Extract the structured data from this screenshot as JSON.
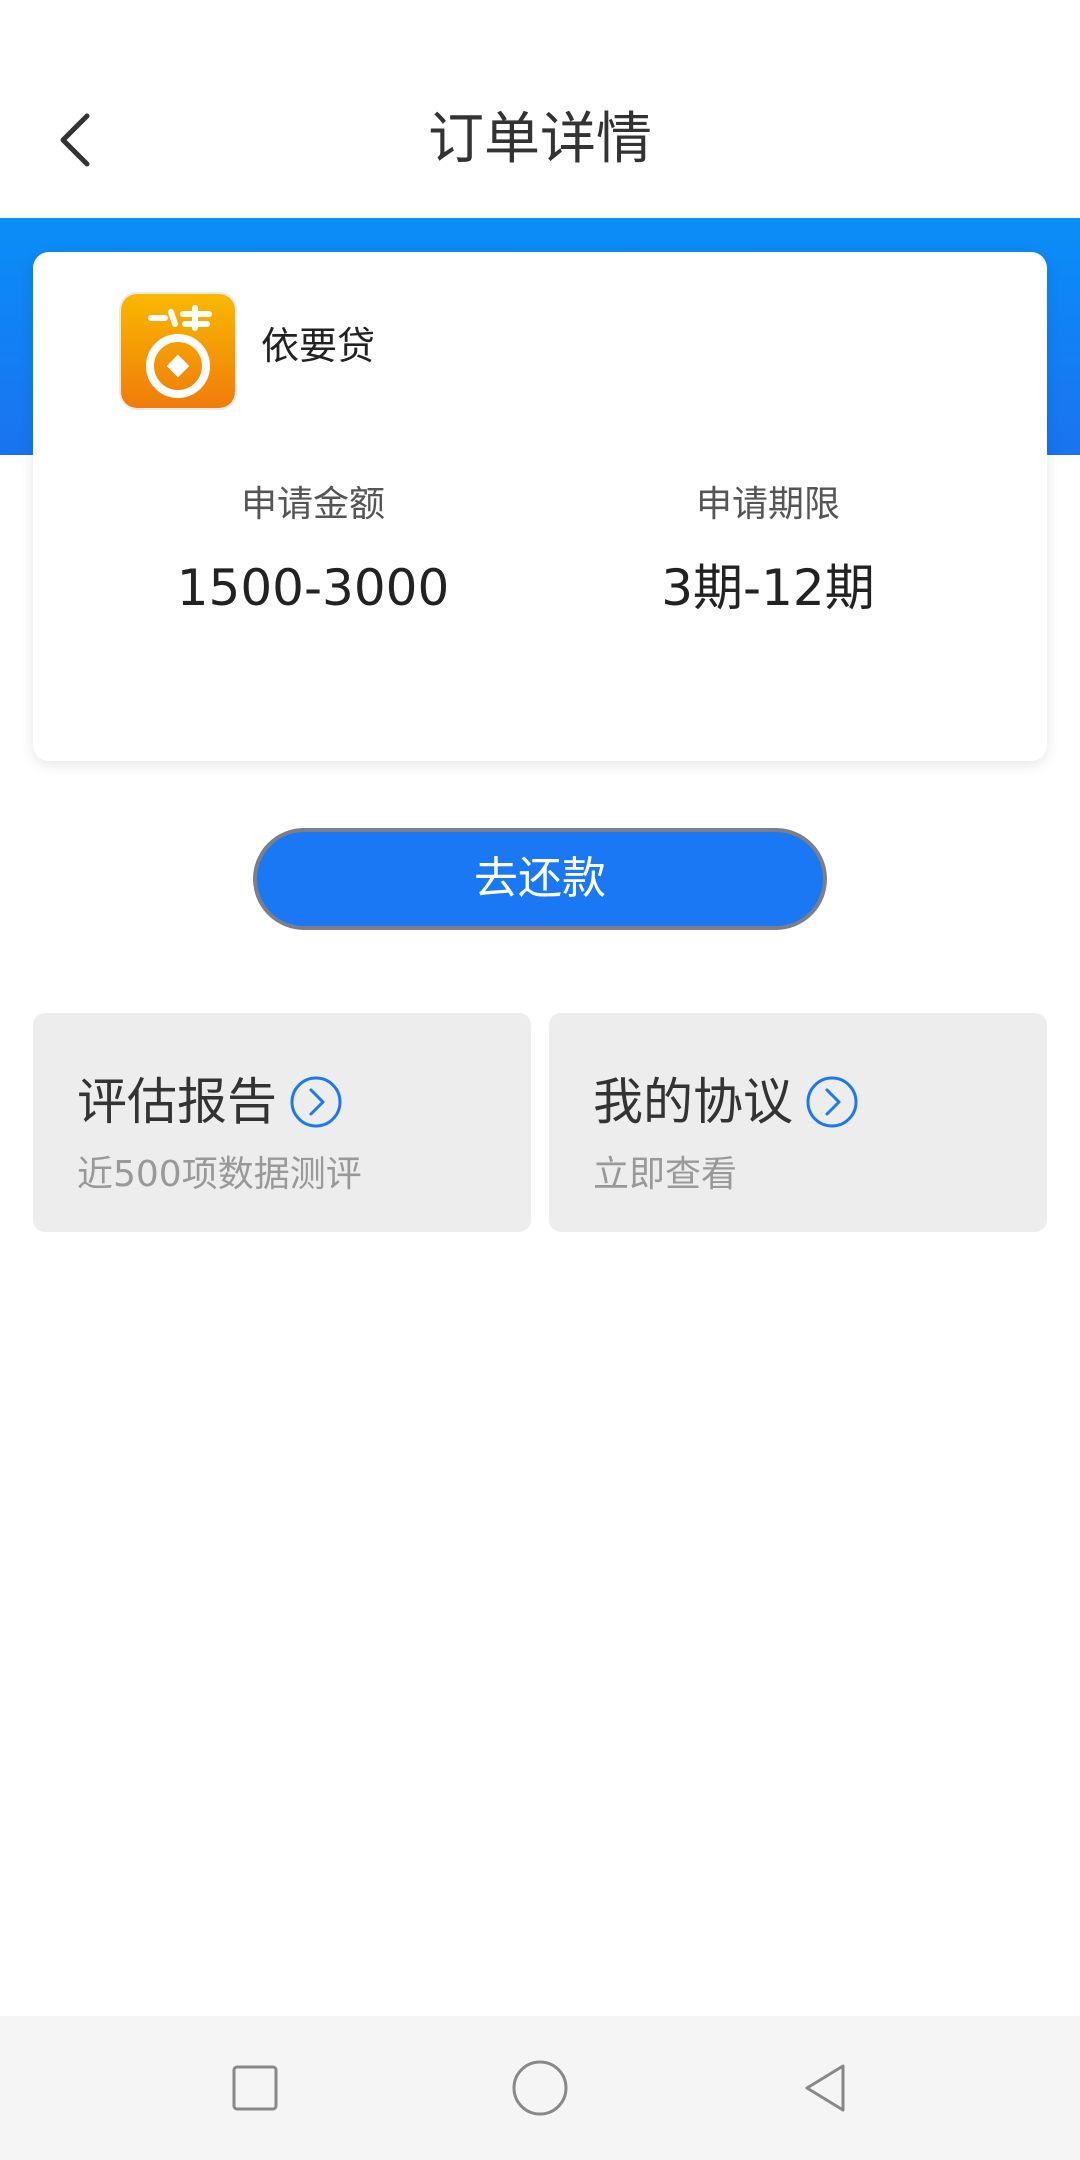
{
  "header": {
    "title": "订单详情"
  },
  "card": {
    "app_name": "依要贷",
    "logo_glyph": "贷",
    "amount_label": "申请金额",
    "amount_value": "1500-3000",
    "term_label": "申请期限",
    "term_value": "3期-12期"
  },
  "actions": {
    "repay_label": "去还款"
  },
  "tiles": [
    {
      "title": "评估报告",
      "subtitle": "近500项数据测评"
    },
    {
      "title": "我的协议",
      "subtitle": "立即查看"
    }
  ],
  "colors": {
    "accent_blue": "#1a78f5",
    "logo_orange": "#f5a10a"
  },
  "icons": {
    "back": "chevron-left-icon",
    "tile_arrow": "circle-chevron-right-icon",
    "nav_recent": "square-icon",
    "nav_home": "circle-icon",
    "nav_back": "triangle-back-icon"
  }
}
